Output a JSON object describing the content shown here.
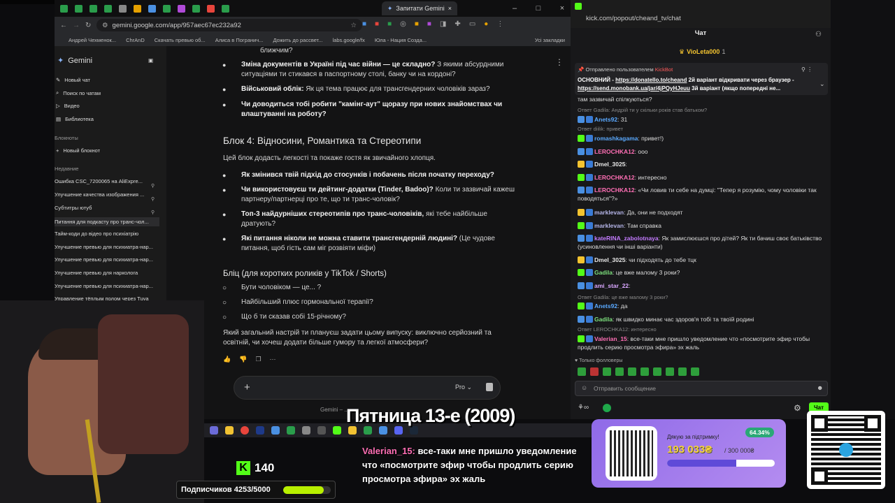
{
  "browser": {
    "active_tab": "Запитати Gemini",
    "url": "gemini.google.com/app/957aec67ec232a92",
    "bookmarks": [
      "Андрей Чехменок...",
      "ChrAnD",
      "Скачать превью об...",
      "Алиса в Погранич...",
      "Дожить до рассвет...",
      "labs.google/fx",
      "Юла - Нация Созда..."
    ],
    "bookmarks_right": "Усі закладки"
  },
  "gemini": {
    "brand": "Gemini",
    "menu": [
      "Новый чат",
      "Поиск по чатам",
      "Видео",
      "Библиотека"
    ],
    "notebooks_header": "Блокноты",
    "new_notebook": "Новый блокнот",
    "recent_header": "Недавние",
    "recent": [
      "Ошибка CSC_7200065 на AliExpre...",
      "Улучшение качества изображения ...",
      "Субтитры ютуб",
      "Питання для подкасту про транс-чол...",
      "Тайм-коди до відео про психіатрію",
      "Улучшение превью для психиатра-нар...",
      "Улучшение превью для психиатра-нар...",
      "Улучшение превью для нарколога",
      "Улучшение превью для психиатра-нар...",
      "Управление тёплым полом через Tuya"
    ]
  },
  "content": {
    "top_fragment": "ближчим?",
    "b1_bold": "Зміна документів в Україні під час війни — це складно?",
    "b1_rest": " З якими абсурдними ситуаціями ти стикався в паспортному столі, банку чи на кордоні?",
    "b2_bold": "Військовий облік:",
    "b2_rest": " Як ця тема працює для трансгендерних чоловіків зараз?",
    "b3_bold": "Чи доводиться тобі робити \"камінг-аут\" щоразу при нових знайомствах чи влаштуванні на роботу?",
    "block4_title": "Блок 4: Відносини, Романтика та Стереотипи",
    "block4_intro": "Цей блок додасть легкості та покаже гостя як звичайного хлопця.",
    "c1_bold": "Як змінився твій підхід до стосунків і побачень після початку переходу?",
    "c2_bold": "Чи використовуєш ти дейтинг-додатки (Tinder, Badoo)?",
    "c2_rest": " Коли ти зазвичай кажеш партнеру/партнерці про те, що ти транс-чоловік?",
    "c3_bold": "Топ-3 найдурніших стереотипів про транс-чоловіків,",
    "c3_rest": " які тебе найбільше дратують?",
    "c4_bold": "Які питання ніколи не можна ставити трансгендерній людині?",
    "c4_rest": " (Це чудове питання, щоб гість сам міг розвіяти міфи)",
    "blitz_title": "Бліц (для коротких роликів у TikTok / Shorts)",
    "blitz": [
      "Бути чоловіком — це... ?",
      "Найбільший плюс гормональної терапії?",
      "Що б ти сказав собі 15-річному?"
    ],
    "closing": "Який загальний настрій ти плануєш задати цьому випуску: виключно серйозний та освітній, чи хочеш додати більше гумору та легкої атмосфери?",
    "pro_label": "Pro",
    "footer": "Gemini – ..."
  },
  "chat": {
    "url": "kick.com/popout/cheand_tv/chat",
    "title": "Чат",
    "top_user": "VioLeta000",
    "top_count": "1",
    "pinned_by": "Отправлено пользователем",
    "pinned_user": "KickBot",
    "pinned_text1": "ОСНОВНИЙ - ",
    "pinned_link1": "https://donatello.to/cheand",
    "pinned_text2": " 2й варіант відкривати через браузер - ",
    "pinned_link2": "https://send.monobank.ua/jar/4jPQyHJeuu",
    "pinned_text3": " 3й варіант (якщо попередні не...",
    "messages": [
      {
        "type": "text",
        "text": "там зазвичай спілкуються?"
      },
      {
        "type": "reply",
        "text": "Ответ Gadila: Андрій ти у скільки років став батьком?"
      },
      {
        "type": "msg",
        "user": "Anets92",
        "color": "#5aa9ff",
        "text": ": 31"
      },
      {
        "type": "reply",
        "text": "Ответ diilik: привет"
      },
      {
        "type": "msg",
        "user": "romashkagama",
        "color": "#5aa9ff",
        "text": ": привет!)"
      },
      {
        "type": "msg",
        "user": "LEROCHKA12",
        "color": "#ff6fb5",
        "text": ": ооо"
      },
      {
        "type": "msg",
        "user": "Dmel_3025",
        "color": "#e8e8e8",
        "text": ":"
      },
      {
        "type": "msg",
        "user": "LEROCHKA12",
        "color": "#ff6fb5",
        "text": ": интересно"
      },
      {
        "type": "msg",
        "user": "LEROCHKA12",
        "color": "#ff6fb5",
        "text": ": «Чи ловив ти себе на думці: \"Тепер я розумію, чому чоловіки так поводяться\"?»"
      },
      {
        "type": "msg",
        "user": "marklevan",
        "color": "#b5b5e8",
        "text": ": Да, они не подходят"
      },
      {
        "type": "msg",
        "user": "marklevan",
        "color": "#b5b5e8",
        "text": ": Там справка"
      },
      {
        "type": "msg",
        "user": "kateRINA_zabolotnaya",
        "color": "#c37bff",
        "text": ": Як замислюєшся про дітей? Як ти бачиш своє батьківство (усиновлення чи інші варіанти)"
      },
      {
        "type": "msg",
        "user": "Dmel_3025",
        "color": "#e8e8e8",
        "text": ": чи підходять до тебе тцк"
      },
      {
        "type": "msg",
        "user": "Gadila",
        "color": "#7de07d",
        "text": ": це вже малому 3 роки?"
      },
      {
        "type": "msg",
        "user": "ami_star_22",
        "color": "#d9a7ff",
        "text": ":"
      },
      {
        "type": "reply",
        "text": "Ответ Gadila: це вже малому 3 роки?"
      },
      {
        "type": "msg",
        "user": "Anets92",
        "color": "#5aa9ff",
        "text": ": да"
      },
      {
        "type": "msg",
        "user": "Gadila",
        "color": "#7de07d",
        "text": ": як швидко минає час здоров'я тобі та твоїй родині"
      },
      {
        "type": "reply",
        "text": "Ответ LEROCHKA12: интересно"
      },
      {
        "type": "msg",
        "user": "Valerian_15",
        "color": "#ff6fb5",
        "text": ": все-таки мне пришло уведомление что «посмотрите эфир чтобы продлить серию просмотра эфира» эх жаль"
      }
    ],
    "followers_only": "Только фолловеры",
    "input_placeholder": "Отправить сообщение",
    "send_label": "Чат"
  },
  "stream": {
    "movie_title": "Пятница 13-е (2009)",
    "kick_count": "140",
    "subscribers": "Подписчиков 4253/5000",
    "sub_progress": 0.85,
    "caption_user": "Valerian_15:",
    "caption_text": " все-таки мне пришло уведомление что «посмотрите эфир чтобы продлить серию просмотра эфира» эх жаль",
    "donate_title": "Дякую за підтримку!",
    "donate_percent": "64.34%",
    "donate_amount": "193 033₴",
    "donate_goal": "/ 300 000₴",
    "donate_progress": 0.6434
  }
}
